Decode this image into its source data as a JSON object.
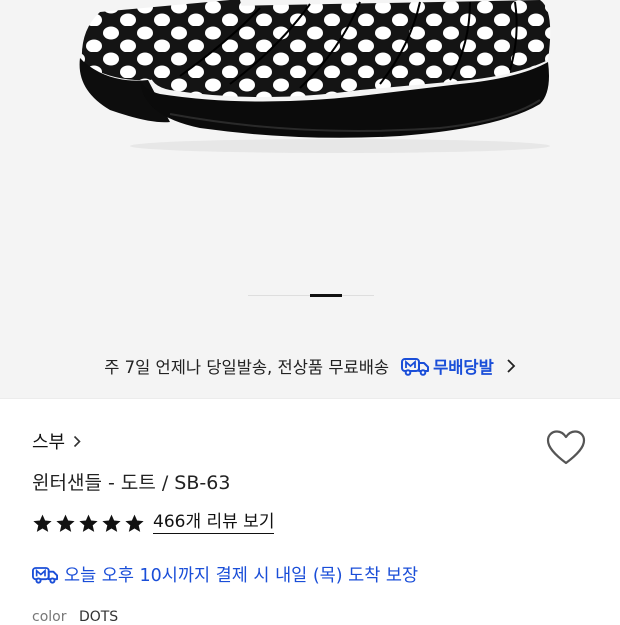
{
  "hero": {
    "image_alt": "Black quilted slippers with white polka dots",
    "carousel": {
      "total": 4,
      "active_index": 2
    }
  },
  "delivery_banner": {
    "text": "주 7일 언제나 당일발송, 전상품 무료배송",
    "badge_label": "무배당발",
    "icon": "truck-icon"
  },
  "product": {
    "brand": "스부",
    "title": "윈터샌들 - 도트 / SB-63",
    "rating_stars": 5,
    "review_link": "466개 리뷰 보기",
    "arrival_text": "오늘 오후 10시까지 결제 시 내일 (목) 도착 보장",
    "option_label": "color",
    "option_value": "DOTS"
  },
  "colors": {
    "accent_blue": "#1a4ed8",
    "text": "#111111",
    "hero_bg": "#f4f4f4"
  }
}
